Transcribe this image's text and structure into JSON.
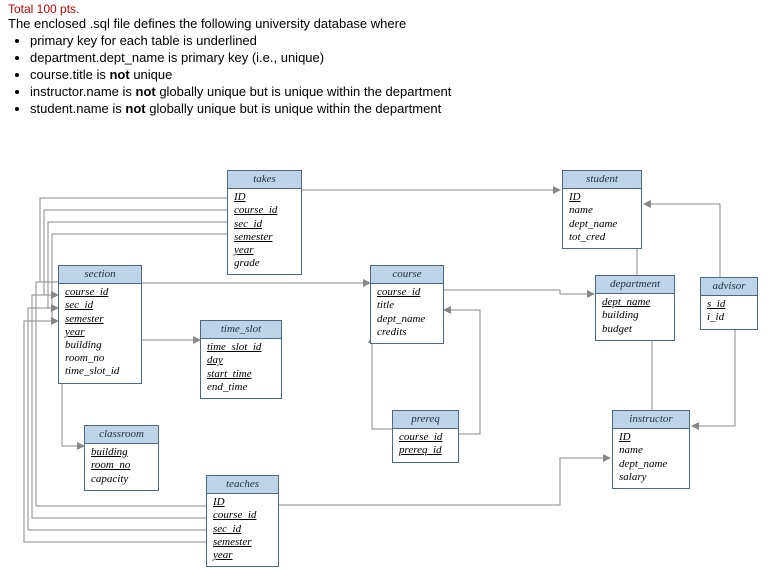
{
  "header": {
    "cutoff": "Total 100 pts.",
    "intro": "The enclosed .sql file defines the following university database where",
    "bullets": [
      {
        "pre": "primary key for each table is underlined",
        "strong": "",
        "post": ""
      },
      {
        "pre": "department.dept_name is primary key (i.e., unique)",
        "strong": "",
        "post": ""
      },
      {
        "pre": "course.title is ",
        "strong": "not",
        "post": " unique"
      },
      {
        "pre": "instructor.name is ",
        "strong": "not",
        "post": " globally unique but is unique within the department"
      },
      {
        "pre": "student.name is ",
        "strong": "not",
        "post": " globally unique but is unique within the department"
      }
    ]
  },
  "entities": {
    "takes": {
      "title": "takes",
      "attrs": [
        {
          "t": "ID",
          "pk": true
        },
        {
          "t": "course_id",
          "pk": true
        },
        {
          "t": "sec_id",
          "pk": true
        },
        {
          "t": "semester",
          "pk": true
        },
        {
          "t": "year",
          "pk": true
        },
        {
          "t": "grade",
          "pk": false
        }
      ]
    },
    "student": {
      "title": "student",
      "attrs": [
        {
          "t": "ID",
          "pk": true
        },
        {
          "t": "name",
          "pk": false
        },
        {
          "t": "dept_name",
          "pk": false
        },
        {
          "t": "tot_cred",
          "pk": false
        }
      ]
    },
    "section": {
      "title": "section",
      "attrs": [
        {
          "t": "course_id",
          "pk": true
        },
        {
          "t": "sec_id",
          "pk": true
        },
        {
          "t": "semester",
          "pk": true
        },
        {
          "t": "year",
          "pk": true
        },
        {
          "t": "building",
          "pk": false
        },
        {
          "t": "room_no",
          "pk": false
        },
        {
          "t": "time_slot_id",
          "pk": false
        }
      ]
    },
    "course": {
      "title": "course",
      "attrs": [
        {
          "t": "course_id",
          "pk": true
        },
        {
          "t": "title",
          "pk": false
        },
        {
          "t": "dept_name",
          "pk": false
        },
        {
          "t": "credits",
          "pk": false
        }
      ]
    },
    "department": {
      "title": "department",
      "attrs": [
        {
          "t": "dept_name",
          "pk": true
        },
        {
          "t": "building",
          "pk": false
        },
        {
          "t": "budget",
          "pk": false
        }
      ]
    },
    "advisor": {
      "title": "advisor",
      "attrs": [
        {
          "t": "s_id",
          "pk": true
        },
        {
          "t": "i_id",
          "pk": false
        }
      ]
    },
    "time_slot": {
      "title": "time_slot",
      "attrs": [
        {
          "t": "time_slot_id",
          "pk": true
        },
        {
          "t": "day",
          "pk": true
        },
        {
          "t": "start_time",
          "pk": true
        },
        {
          "t": "end_time",
          "pk": false
        }
      ]
    },
    "prereq": {
      "title": "prereq",
      "attrs": [
        {
          "t": "course_id",
          "pk": true
        },
        {
          "t": "prereq_id",
          "pk": true
        }
      ]
    },
    "instructor": {
      "title": "instructor",
      "attrs": [
        {
          "t": "ID",
          "pk": true
        },
        {
          "t": "name",
          "pk": false
        },
        {
          "t": "dept_name",
          "pk": false
        },
        {
          "t": "salary",
          "pk": false
        }
      ]
    },
    "classroom": {
      "title": "classroom",
      "attrs": [
        {
          "t": "building",
          "pk": true
        },
        {
          "t": "room_no",
          "pk": true
        },
        {
          "t": "capacity",
          "pk": false
        }
      ]
    },
    "teaches": {
      "title": "teaches",
      "attrs": [
        {
          "t": "ID",
          "pk": true
        },
        {
          "t": "course_id",
          "pk": true
        },
        {
          "t": "sec_id",
          "pk": true
        },
        {
          "t": "semester",
          "pk": true
        },
        {
          "t": "year",
          "pk": true
        }
      ]
    }
  }
}
